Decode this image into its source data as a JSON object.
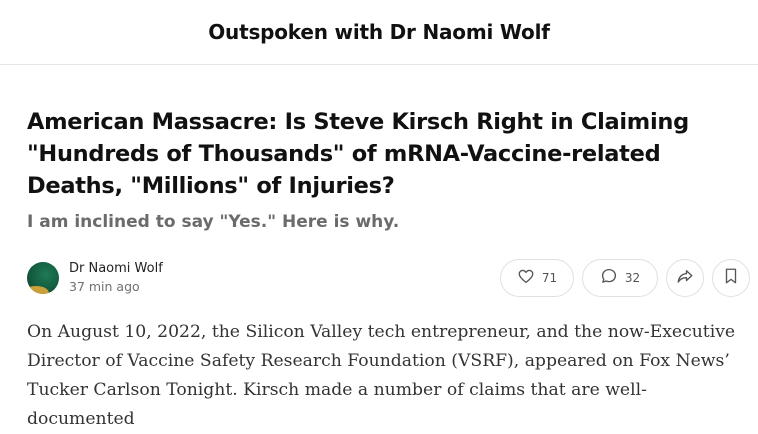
{
  "publication": {
    "title": "Outspoken with Dr Naomi Wolf"
  },
  "post": {
    "title": "American Massacre: Is Steve Kirsch Right in Claiming \"Hundreds of Thousands\" of mRNA-Vaccine-related Deaths, \"Millions\" of Injuries?",
    "subtitle": "I am inclined to say \"Yes.\" Here is why.",
    "author": "Dr Naomi Wolf",
    "time": "37 min ago",
    "body": "On August 10, 2022, the Silicon Valley tech entrepreneur, and the now-Executive Director of Vaccine Safety Research Foundation (VSRF), appeared on Fox News’ Tucker Carlson Tonight. Kirsch made a number of claims that are well-documented"
  },
  "actions": {
    "like_count": "71",
    "comment_count": "32"
  },
  "icons": {
    "like": "heart-icon",
    "comment": "comment-bubble-icon",
    "share": "share-arrow-icon",
    "bookmark": "bookmark-icon"
  },
  "colors": {
    "avatar": "#135c40",
    "avatar_accent": "#e0a93a",
    "subtitle": "#6b6b6b"
  }
}
